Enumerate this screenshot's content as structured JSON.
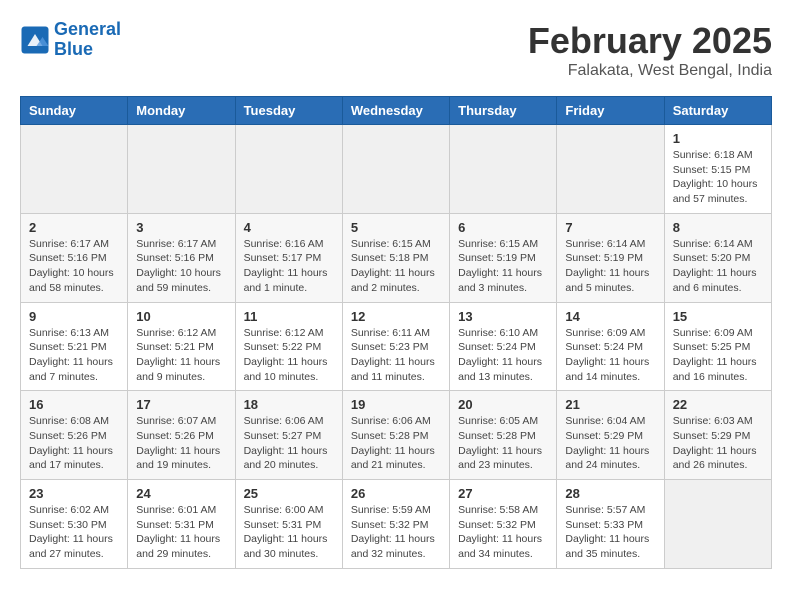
{
  "header": {
    "logo_line1": "General",
    "logo_line2": "Blue",
    "month": "February 2025",
    "location": "Falakata, West Bengal, India"
  },
  "days_of_week": [
    "Sunday",
    "Monday",
    "Tuesday",
    "Wednesday",
    "Thursday",
    "Friday",
    "Saturday"
  ],
  "weeks": [
    [
      {
        "day": "",
        "info": ""
      },
      {
        "day": "",
        "info": ""
      },
      {
        "day": "",
        "info": ""
      },
      {
        "day": "",
        "info": ""
      },
      {
        "day": "",
        "info": ""
      },
      {
        "day": "",
        "info": ""
      },
      {
        "day": "1",
        "info": "Sunrise: 6:18 AM\nSunset: 5:15 PM\nDaylight: 10 hours\nand 57 minutes."
      }
    ],
    [
      {
        "day": "2",
        "info": "Sunrise: 6:17 AM\nSunset: 5:16 PM\nDaylight: 10 hours\nand 58 minutes."
      },
      {
        "day": "3",
        "info": "Sunrise: 6:17 AM\nSunset: 5:16 PM\nDaylight: 10 hours\nand 59 minutes."
      },
      {
        "day": "4",
        "info": "Sunrise: 6:16 AM\nSunset: 5:17 PM\nDaylight: 11 hours\nand 1 minute."
      },
      {
        "day": "5",
        "info": "Sunrise: 6:15 AM\nSunset: 5:18 PM\nDaylight: 11 hours\nand 2 minutes."
      },
      {
        "day": "6",
        "info": "Sunrise: 6:15 AM\nSunset: 5:19 PM\nDaylight: 11 hours\nand 3 minutes."
      },
      {
        "day": "7",
        "info": "Sunrise: 6:14 AM\nSunset: 5:19 PM\nDaylight: 11 hours\nand 5 minutes."
      },
      {
        "day": "8",
        "info": "Sunrise: 6:14 AM\nSunset: 5:20 PM\nDaylight: 11 hours\nand 6 minutes."
      }
    ],
    [
      {
        "day": "9",
        "info": "Sunrise: 6:13 AM\nSunset: 5:21 PM\nDaylight: 11 hours\nand 7 minutes."
      },
      {
        "day": "10",
        "info": "Sunrise: 6:12 AM\nSunset: 5:21 PM\nDaylight: 11 hours\nand 9 minutes."
      },
      {
        "day": "11",
        "info": "Sunrise: 6:12 AM\nSunset: 5:22 PM\nDaylight: 11 hours\nand 10 minutes."
      },
      {
        "day": "12",
        "info": "Sunrise: 6:11 AM\nSunset: 5:23 PM\nDaylight: 11 hours\nand 11 minutes."
      },
      {
        "day": "13",
        "info": "Sunrise: 6:10 AM\nSunset: 5:24 PM\nDaylight: 11 hours\nand 13 minutes."
      },
      {
        "day": "14",
        "info": "Sunrise: 6:09 AM\nSunset: 5:24 PM\nDaylight: 11 hours\nand 14 minutes."
      },
      {
        "day": "15",
        "info": "Sunrise: 6:09 AM\nSunset: 5:25 PM\nDaylight: 11 hours\nand 16 minutes."
      }
    ],
    [
      {
        "day": "16",
        "info": "Sunrise: 6:08 AM\nSunset: 5:26 PM\nDaylight: 11 hours\nand 17 minutes."
      },
      {
        "day": "17",
        "info": "Sunrise: 6:07 AM\nSunset: 5:26 PM\nDaylight: 11 hours\nand 19 minutes."
      },
      {
        "day": "18",
        "info": "Sunrise: 6:06 AM\nSunset: 5:27 PM\nDaylight: 11 hours\nand 20 minutes."
      },
      {
        "day": "19",
        "info": "Sunrise: 6:06 AM\nSunset: 5:28 PM\nDaylight: 11 hours\nand 21 minutes."
      },
      {
        "day": "20",
        "info": "Sunrise: 6:05 AM\nSunset: 5:28 PM\nDaylight: 11 hours\nand 23 minutes."
      },
      {
        "day": "21",
        "info": "Sunrise: 6:04 AM\nSunset: 5:29 PM\nDaylight: 11 hours\nand 24 minutes."
      },
      {
        "day": "22",
        "info": "Sunrise: 6:03 AM\nSunset: 5:29 PM\nDaylight: 11 hours\nand 26 minutes."
      }
    ],
    [
      {
        "day": "23",
        "info": "Sunrise: 6:02 AM\nSunset: 5:30 PM\nDaylight: 11 hours\nand 27 minutes."
      },
      {
        "day": "24",
        "info": "Sunrise: 6:01 AM\nSunset: 5:31 PM\nDaylight: 11 hours\nand 29 minutes."
      },
      {
        "day": "25",
        "info": "Sunrise: 6:00 AM\nSunset: 5:31 PM\nDaylight: 11 hours\nand 30 minutes."
      },
      {
        "day": "26",
        "info": "Sunrise: 5:59 AM\nSunset: 5:32 PM\nDaylight: 11 hours\nand 32 minutes."
      },
      {
        "day": "27",
        "info": "Sunrise: 5:58 AM\nSunset: 5:32 PM\nDaylight: 11 hours\nand 34 minutes."
      },
      {
        "day": "28",
        "info": "Sunrise: 5:57 AM\nSunset: 5:33 PM\nDaylight: 11 hours\nand 35 minutes."
      },
      {
        "day": "",
        "info": ""
      }
    ]
  ]
}
